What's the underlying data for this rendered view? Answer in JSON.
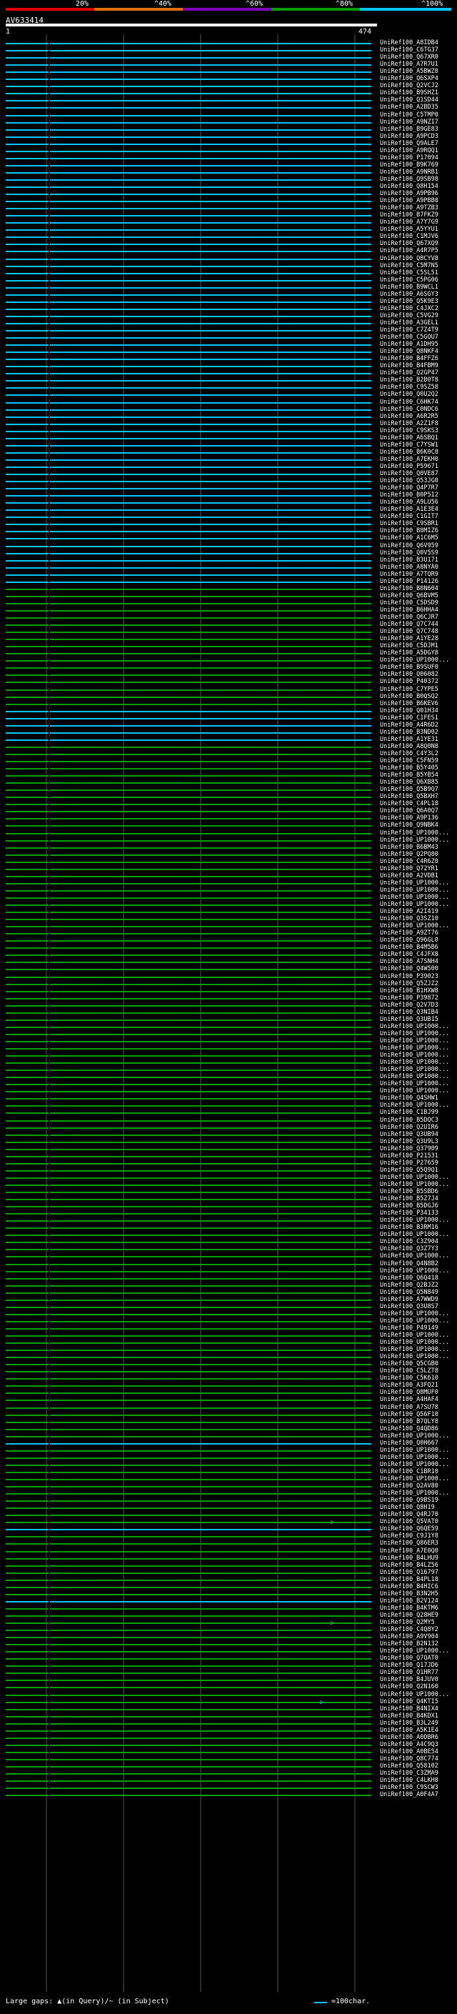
{
  "legend": {
    "labels": [
      "20%",
      "^40%",
      "^60%",
      "^80%",
      "^100%"
    ],
    "colors": [
      "#e00000",
      "#e07000",
      "#8000c0",
      "#00a000",
      "#00c8ff"
    ]
  },
  "query": {
    "name": "AV633414",
    "start": "1",
    "end": "474"
  },
  "footer": {
    "text": "Large gaps: ▲(in Query)/~ (in Subject)",
    "scale": "=100char."
  },
  "colors": {
    "high": "#00c8ff",
    "mid": "#00a000",
    "marker": "#000000"
  },
  "hits": [
    {
      "label": "UniRef100_A8IDB4",
      "tier": "high"
    },
    {
      "label": "UniRef100_C6TG37",
      "tier": "high"
    },
    {
      "label": "UniRef100_Q67XR0",
      "tier": "high"
    },
    {
      "label": "UniRef100_A7R7U1",
      "tier": "high"
    },
    {
      "label": "UniRef100_A5BWZ0",
      "tier": "high"
    },
    {
      "label": "UniRef100_Q6SXP4",
      "tier": "high"
    },
    {
      "label": "UniRef100_Q2VCJ2",
      "tier": "high"
    },
    {
      "label": "UniRef100_B9SHZ1",
      "tier": "high"
    },
    {
      "label": "UniRef100_Q1SD44",
      "tier": "high"
    },
    {
      "label": "UniRef100_A2BD35",
      "tier": "high"
    },
    {
      "label": "UniRef100_C5TMP0",
      "tier": "high"
    },
    {
      "label": "UniRef100_A9NZI7",
      "tier": "high"
    },
    {
      "label": "UniRef100_B9GE83",
      "tier": "high"
    },
    {
      "label": "UniRef100_A9PCD3",
      "tier": "high"
    },
    {
      "label": "UniRef100_Q9ALE7",
      "tier": "high"
    },
    {
      "label": "UniRef100_A9RQQ1",
      "tier": "high"
    },
    {
      "label": "UniRef100_P17094",
      "tier": "high"
    },
    {
      "label": "UniRef100_B9K769",
      "tier": "high"
    },
    {
      "label": "UniRef100_A9NRB1",
      "tier": "high"
    },
    {
      "label": "UniRef100_Q9SB98",
      "tier": "high"
    },
    {
      "label": "UniRef100_Q8H154",
      "tier": "high"
    },
    {
      "label": "UniRef100_A9PB96",
      "tier": "high"
    },
    {
      "label": "UniRef100_A9PBB0",
      "tier": "high"
    },
    {
      "label": "UniRef100_A9TZB3",
      "tier": "high"
    },
    {
      "label": "UniRef100_B7FKZ9",
      "tier": "high"
    },
    {
      "label": "UniRef100_A7Y7G9",
      "tier": "high"
    },
    {
      "label": "UniRef100_A5YYU1",
      "tier": "high"
    },
    {
      "label": "UniRef100_C1MJV6",
      "tier": "high"
    },
    {
      "label": "UniRef100_Q67XQ9",
      "tier": "high"
    },
    {
      "label": "UniRef100_A4R7P5",
      "tier": "high"
    },
    {
      "label": "UniRef100_Q0CYV8",
      "tier": "high"
    },
    {
      "label": "UniRef100_C5M7N5",
      "tier": "high"
    },
    {
      "label": "UniRef100_C5SL51",
      "tier": "high"
    },
    {
      "label": "UniRef100_C5PG06",
      "tier": "high"
    },
    {
      "label": "UniRef100_B9WCL1",
      "tier": "high"
    },
    {
      "label": "UniRef100_A6SGY3",
      "tier": "high"
    },
    {
      "label": "UniRef100_Q5K9E3",
      "tier": "high"
    },
    {
      "label": "UniRef100_C4JXC2",
      "tier": "high"
    },
    {
      "label": "UniRef100_C5VG29",
      "tier": "high"
    },
    {
      "label": "UniRef100_A3GEL1",
      "tier": "high"
    },
    {
      "label": "UniRef100_C7Z4T9",
      "tier": "high"
    },
    {
      "label": "UniRef100_C5GQU7",
      "tier": "high"
    },
    {
      "label": "UniRef100_A1DH95",
      "tier": "high"
    },
    {
      "label": "UniRef100_Q8NKF4",
      "tier": "high"
    },
    {
      "label": "UniRef100_B4FFZ6",
      "tier": "high"
    },
    {
      "label": "UniRef100_B4FBM9",
      "tier": "high"
    },
    {
      "label": "UniRef100_Q2GP47",
      "tier": "high"
    },
    {
      "label": "UniRef100_B2B0T8",
      "tier": "high"
    },
    {
      "label": "UniRef100_C9SZ58",
      "tier": "high"
    },
    {
      "label": "UniRef100_Q0U2Q2",
      "tier": "high"
    },
    {
      "label": "UniRef100_C6HK74",
      "tier": "high"
    },
    {
      "label": "UniRef100_C0NDC6",
      "tier": "high"
    },
    {
      "label": "UniRef100_A6R2R5",
      "tier": "high"
    },
    {
      "label": "UniRef100_A2Z1F8",
      "tier": "high"
    },
    {
      "label": "UniRef100_C9SKS3",
      "tier": "high"
    },
    {
      "label": "UniRef100_A6SBQ1",
      "tier": "high"
    },
    {
      "label": "UniRef100_C7YSW1",
      "tier": "high"
    },
    {
      "label": "UniRef100_B6K0C8",
      "tier": "high"
    },
    {
      "label": "UniRef100_A7EKH0",
      "tier": "high"
    },
    {
      "label": "UniRef100_P59671",
      "tier": "high"
    },
    {
      "label": "UniRef100_Q0VE87",
      "tier": "high"
    },
    {
      "label": "UniRef100_Q53JG0",
      "tier": "high"
    },
    {
      "label": "UniRef100_Q4P7R7",
      "tier": "high"
    },
    {
      "label": "UniRef100_B0P5I2",
      "tier": "high"
    },
    {
      "label": "UniRef100_A9LU56",
      "tier": "high"
    },
    {
      "label": "UniRef100_A1E3E4",
      "tier": "high"
    },
    {
      "label": "UniRef100_C1GIT7",
      "tier": "high"
    },
    {
      "label": "UniRef100_C9SBR1",
      "tier": "high"
    },
    {
      "label": "UniRef100_B8MIZ6",
      "tier": "high"
    },
    {
      "label": "UniRef100_A1C6M5",
      "tier": "high"
    },
    {
      "label": "UniRef100_Q6V959",
      "tier": "high"
    },
    {
      "label": "UniRef100_Q0V5S9",
      "tier": "high"
    },
    {
      "label": "UniRef100_B3U171",
      "tier": "high"
    },
    {
      "label": "UniRef100_A8NYA0",
      "tier": "high"
    },
    {
      "label": "UniRef100_A7TQR9",
      "tier": "high"
    },
    {
      "label": "UniRef100_P14126",
      "tier": "high"
    },
    {
      "label": "UniRef100_B8N604",
      "tier": "mid"
    },
    {
      "label": "UniRef100_Q6BVM5",
      "tier": "mid"
    },
    {
      "label": "UniRef100_C5DSD9",
      "tier": "mid"
    },
    {
      "label": "UniRef100_B6HHA4",
      "tier": "mid"
    },
    {
      "label": "UniRef100_Q6CJR7",
      "tier": "mid"
    },
    {
      "label": "UniRef100_Q7C744",
      "tier": "mid"
    },
    {
      "label": "UniRef100_Q7C748",
      "tier": "mid"
    },
    {
      "label": "UniRef100_A1YE28",
      "tier": "mid"
    },
    {
      "label": "UniRef100_C5DJM1",
      "tier": "mid"
    },
    {
      "label": "UniRef100_A5DGY8",
      "tier": "mid"
    },
    {
      "label": "UniRef100_UP1000...",
      "tier": "mid"
    },
    {
      "label": "UniRef100_B9SUF0",
      "tier": "mid"
    },
    {
      "label": "UniRef100_Q06082",
      "tier": "mid"
    },
    {
      "label": "UniRef100_P40372",
      "tier": "mid"
    },
    {
      "label": "UniRef100_C7YPE5",
      "tier": "mid"
    },
    {
      "label": "UniRef100_B0QSQ2",
      "tier": "mid"
    },
    {
      "label": "UniRef100_B6KEV6",
      "tier": "mid"
    },
    {
      "label": "UniRef100_Q01H34",
      "tier": "high"
    },
    {
      "label": "UniRef100_C1FES1",
      "tier": "high"
    },
    {
      "label": "UniRef100_A4R6D2",
      "tier": "high"
    },
    {
      "label": "UniRef100_B3ND02",
      "tier": "high"
    },
    {
      "label": "UniRef100_A1YE31",
      "tier": "high"
    },
    {
      "label": "UniRef100_A8Q0N8",
      "tier": "mid"
    },
    {
      "label": "UniRef100_C4Y3L2",
      "tier": "mid"
    },
    {
      "label": "UniRef100_C5FN59",
      "tier": "mid"
    },
    {
      "label": "UniRef100_B5Y405",
      "tier": "mid"
    },
    {
      "label": "UniRef100_B5YB54",
      "tier": "mid"
    },
    {
      "label": "UniRef100_Q6XB85",
      "tier": "mid"
    },
    {
      "label": "UniRef100_Q5B9Q7",
      "tier": "mid"
    },
    {
      "label": "UniRef100_Q5BXH7",
      "tier": "mid"
    },
    {
      "label": "UniRef100_C4PL18",
      "tier": "mid"
    },
    {
      "label": "UniRef100_Q6A0Q7",
      "tier": "mid"
    },
    {
      "label": "UniRef100_A9P136",
      "tier": "mid"
    },
    {
      "label": "UniRef100_Q9NBK4",
      "tier": "mid"
    },
    {
      "label": "UniRef100_UP1000...",
      "tier": "mid"
    },
    {
      "label": "UniRef100_UP1000...",
      "tier": "mid"
    },
    {
      "label": "UniRef100_B6BM43",
      "tier": "mid"
    },
    {
      "label": "UniRef100_Q2PQ80",
      "tier": "mid"
    },
    {
      "label": "UniRef100_C4R6Z0",
      "tier": "mid"
    },
    {
      "label": "UniRef100_Q72YR1",
      "tier": "mid"
    },
    {
      "label": "UniRef100_A2VDB1",
      "tier": "mid"
    },
    {
      "label": "UniRef100_UP1000...",
      "tier": "mid"
    },
    {
      "label": "UniRef100_UP1000...",
      "tier": "mid"
    },
    {
      "label": "UniRef100_UP1000...",
      "tier": "mid"
    },
    {
      "label": "UniRef100_UP1000...",
      "tier": "mid"
    },
    {
      "label": "UniRef100_A2I419",
      "tier": "mid"
    },
    {
      "label": "UniRef100_Q3SZ10",
      "tier": "mid"
    },
    {
      "label": "UniRef100_UP1000...",
      "tier": "mid"
    },
    {
      "label": "UniRef100_A9ZT76",
      "tier": "mid"
    },
    {
      "label": "UniRef100_Q96GL0",
      "tier": "mid"
    },
    {
      "label": "UniRef100_B4M5B6",
      "tier": "mid"
    },
    {
      "label": "UniRef100_C4JFX8",
      "tier": "mid"
    },
    {
      "label": "UniRef100_A7SNH4",
      "tier": "mid"
    },
    {
      "label": "UniRef100_Q4W500",
      "tier": "mid"
    },
    {
      "label": "UniRef100_P39023",
      "tier": "mid"
    },
    {
      "label": "UniRef100_Q5ZJZ2",
      "tier": "mid"
    },
    {
      "label": "UniRef100_B1HXW8",
      "tier": "mid"
    },
    {
      "label": "UniRef100_P39872",
      "tier": "mid"
    },
    {
      "label": "UniRef100_Q2V7D3",
      "tier": "mid"
    },
    {
      "label": "UniRef100_Q3NIB4",
      "tier": "mid"
    },
    {
      "label": "UniRef100_Q3UB15",
      "tier": "mid"
    },
    {
      "label": "UniRef100_UP1000...",
      "tier": "mid"
    },
    {
      "label": "UniRef100_UP1000...",
      "tier": "mid"
    },
    {
      "label": "UniRef100_UP1000...",
      "tier": "mid"
    },
    {
      "label": "UniRef100_UP1000...",
      "tier": "mid"
    },
    {
      "label": "UniRef100_UP1000...",
      "tier": "mid"
    },
    {
      "label": "UniRef100_UP1000...",
      "tier": "mid"
    },
    {
      "label": "UniRef100_UP1000...",
      "tier": "mid"
    },
    {
      "label": "UniRef100_UP1000...",
      "tier": "mid"
    },
    {
      "label": "UniRef100_UP1000...",
      "tier": "mid"
    },
    {
      "label": "UniRef100_UP1000...",
      "tier": "mid"
    },
    {
      "label": "UniRef100_Q4SHW1",
      "tier": "mid"
    },
    {
      "label": "UniRef100_UP1000...",
      "tier": "mid"
    },
    {
      "label": "UniRef100_C1BJ99",
      "tier": "mid"
    },
    {
      "label": "UniRef100_B5DQC3",
      "tier": "mid"
    },
    {
      "label": "UniRef100_Q2UIR6",
      "tier": "mid"
    },
    {
      "label": "UniRef100_Q3UB94",
      "tier": "mid"
    },
    {
      "label": "UniRef100_Q3U9L3",
      "tier": "mid"
    },
    {
      "label": "UniRef100_Q37909",
      "tier": "mid"
    },
    {
      "label": "UniRef100_P21531",
      "tier": "mid"
    },
    {
      "label": "UniRef100_P27659",
      "tier": "mid"
    },
    {
      "label": "UniRef100_Q5Q9Q1",
      "tier": "mid"
    },
    {
      "label": "UniRef100_UP1000...",
      "tier": "mid"
    },
    {
      "label": "UniRef100_UP1000...",
      "tier": "mid"
    },
    {
      "label": "UniRef100_B5SBD6",
      "tier": "mid"
    },
    {
      "label": "UniRef100_B5Z7J4",
      "tier": "mid"
    },
    {
      "label": "UniRef100_B5DGJ6",
      "tier": "mid"
    },
    {
      "label": "UniRef100_P34133",
      "tier": "mid"
    },
    {
      "label": "UniRef100_UP1000...",
      "tier": "mid"
    },
    {
      "label": "UniRef100_B3RM16",
      "tier": "mid"
    },
    {
      "label": "UniRef100_UP1000...",
      "tier": "mid"
    },
    {
      "label": "UniRef100_C3Z904",
      "tier": "mid"
    },
    {
      "label": "UniRef100_Q3Z7Y3",
      "tier": "mid"
    },
    {
      "label": "UniRef100_UP1000...",
      "tier": "mid"
    },
    {
      "label": "UniRef100_Q4N8B2",
      "tier": "mid"
    },
    {
      "label": "UniRef100_UP1000...",
      "tier": "mid"
    },
    {
      "label": "UniRef100_Q6Q418",
      "tier": "mid"
    },
    {
      "label": "UniRef100_Q2BJZ2",
      "tier": "mid"
    },
    {
      "label": "UniRef100_Q5N849",
      "tier": "mid"
    },
    {
      "label": "UniRef100_A7WWD9",
      "tier": "mid"
    },
    {
      "label": "UniRef100_Q3U8S7",
      "tier": "mid"
    },
    {
      "label": "UniRef100_UP1000...",
      "tier": "mid"
    },
    {
      "label": "UniRef100_UP1000...",
      "tier": "mid"
    },
    {
      "label": "UniRef100_P49149",
      "tier": "mid"
    },
    {
      "label": "UniRef100_UP1000...",
      "tier": "mid"
    },
    {
      "label": "UniRef100_UP1000...",
      "tier": "mid"
    },
    {
      "label": "UniRef100_UP1000...",
      "tier": "mid"
    },
    {
      "label": "UniRef100_UP1000...",
      "tier": "mid"
    },
    {
      "label": "UniRef100_Q5CGB0",
      "tier": "mid"
    },
    {
      "label": "UniRef100_C5LZT8",
      "tier": "mid"
    },
    {
      "label": "UniRef100_C5K610",
      "tier": "mid"
    },
    {
      "label": "UniRef100_A3FQ21",
      "tier": "mid"
    },
    {
      "label": "UniRef100_Q8MUF0",
      "tier": "mid"
    },
    {
      "label": "UniRef100_A4HAF4",
      "tier": "mid"
    },
    {
      "label": "UniRef100_A7SU78",
      "tier": "mid"
    },
    {
      "label": "UniRef100_Q56F10",
      "tier": "mid"
    },
    {
      "label": "UniRef100_B7QLY8",
      "tier": "mid"
    },
    {
      "label": "UniRef100_Q4QD86",
      "tier": "mid"
    },
    {
      "label": "UniRef100_UP1000...",
      "tier": "mid"
    },
    {
      "label": "UniRef100_Q0H667",
      "tier": "high"
    },
    {
      "label": "UniRef100_UP1000...",
      "tier": "mid"
    },
    {
      "label": "UniRef100_UP1000...",
      "tier": "mid"
    },
    {
      "label": "UniRef100_UP1000...",
      "tier": "mid"
    },
    {
      "label": "UniRef100_C1BR10",
      "tier": "mid"
    },
    {
      "label": "UniRef100_UP1000...",
      "tier": "mid"
    },
    {
      "label": "UniRef100_Q2AV80",
      "tier": "mid"
    },
    {
      "label": "UniRef100_UP1000...",
      "tier": "mid"
    },
    {
      "label": "UniRef100_Q9BS19",
      "tier": "mid"
    },
    {
      "label": "UniRef100_Q8H19",
      "tier": "mid"
    },
    {
      "label": "UniRef100_Q4RJ70",
      "tier": "mid"
    },
    {
      "label": "UniRef100_Q5VAT0",
      "tier": "mid"
    },
    {
      "label": "UniRef100_Q6QE59",
      "tier": "high"
    },
    {
      "label": "UniRef100_C9J1Y8",
      "tier": "mid"
    },
    {
      "label": "UniRef100_Q86ER3",
      "tier": "mid"
    },
    {
      "label": "UniRef100_A7E0Q0",
      "tier": "mid"
    },
    {
      "label": "UniRef100_B4LHU9",
      "tier": "mid"
    },
    {
      "label": "UniRef100_B4LZ56",
      "tier": "mid"
    },
    {
      "label": "UniRef100_Q16797",
      "tier": "mid"
    },
    {
      "label": "UniRef100_B4PL18",
      "tier": "mid"
    },
    {
      "label": "UniRef100_B4HIC6",
      "tier": "mid"
    },
    {
      "label": "UniRef100_B3N2H5",
      "tier": "mid"
    },
    {
      "label": "UniRef100_B2V124",
      "tier": "high"
    },
    {
      "label": "UniRef100_B4KTM6",
      "tier": "mid"
    },
    {
      "label": "UniRef100_Q28HE9",
      "tier": "mid"
    },
    {
      "label": "UniRef100_Q2MY5",
      "tier": "mid"
    },
    {
      "label": "UniRef100_C4Q8Y2",
      "tier": "mid"
    },
    {
      "label": "UniRef100_A9V904",
      "tier": "mid"
    },
    {
      "label": "UniRef100_B2N132",
      "tier": "mid"
    },
    {
      "label": "UniRef100_UP1000...",
      "tier": "mid"
    },
    {
      "label": "UniRef100_Q7QAT0",
      "tier": "mid"
    },
    {
      "label": "UniRef100_Q17JD6",
      "tier": "mid"
    },
    {
      "label": "UniRef100_Q1HR77",
      "tier": "mid"
    },
    {
      "label": "UniRef100_B4JUV0",
      "tier": "mid"
    },
    {
      "label": "UniRef100_Q2N160",
      "tier": "mid"
    },
    {
      "label": "UniRef100_UP1000...",
      "tier": "mid"
    },
    {
      "label": "UniRef100_Q4KTI5",
      "tier": "mid"
    },
    {
      "label": "UniRef100_B4NIX4",
      "tier": "mid"
    },
    {
      "label": "UniRef100_B4KDX1",
      "tier": "mid"
    },
    {
      "label": "UniRef100_B3L249",
      "tier": "mid"
    },
    {
      "label": "UniRef100_A5K1E4",
      "tier": "mid"
    },
    {
      "label": "UniRef100_A0DBR6",
      "tier": "mid"
    },
    {
      "label": "UniRef100_A4C9Q3",
      "tier": "mid"
    },
    {
      "label": "UniRef100_A0BE54",
      "tier": "mid"
    },
    {
      "label": "UniRef100_Q8C774",
      "tier": "mid"
    },
    {
      "label": "UniRef100_Q58102",
      "tier": "mid"
    },
    {
      "label": "UniRef100_C3ZMA9",
      "tier": "mid"
    },
    {
      "label": "UniRef100_C4LKH8",
      "tier": "mid"
    },
    {
      "label": "UniRef100_C9SCW3",
      "tier": "mid"
    },
    {
      "label": "UniRef100_A0F4A7",
      "tier": "mid"
    }
  ],
  "long_hits": [
    206,
    220,
    231
  ]
}
